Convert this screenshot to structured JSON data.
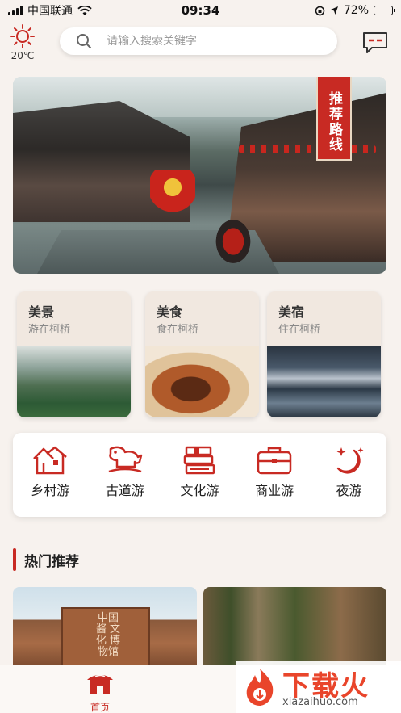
{
  "status_bar": {
    "carrier": "中国联通",
    "time": "09:34",
    "battery_percent": "72%",
    "battery_level": 0.72
  },
  "weather": {
    "temperature": "20℃",
    "icon": "sun-icon"
  },
  "search": {
    "placeholder": "请输入搜索关键字",
    "value": ""
  },
  "banner": {
    "badge": "推荐路线"
  },
  "categories": [
    {
      "title": "美景",
      "subtitle": "游在柯桥"
    },
    {
      "title": "美食",
      "subtitle": "食在柯桥"
    },
    {
      "title": "美宿",
      "subtitle": "住在柯桥"
    }
  ],
  "tours": [
    {
      "label": "乡村游",
      "icon": "village-house-icon"
    },
    {
      "label": "古道游",
      "icon": "horse-icon"
    },
    {
      "label": "文化游",
      "icon": "books-icon"
    },
    {
      "label": "商业游",
      "icon": "briefcase-icon"
    },
    {
      "label": "夜游",
      "icon": "moon-stars-icon"
    }
  ],
  "hot": {
    "title": "热门推荐",
    "museum_sign": "中国 酱 文化 博物馆"
  },
  "tab_bar": {
    "home_label": "首页"
  },
  "watermark": {
    "text": "下载火",
    "domain": "xiazaihuo.com"
  },
  "colors": {
    "accent": "#c82a23",
    "background": "#f7f2ee"
  }
}
